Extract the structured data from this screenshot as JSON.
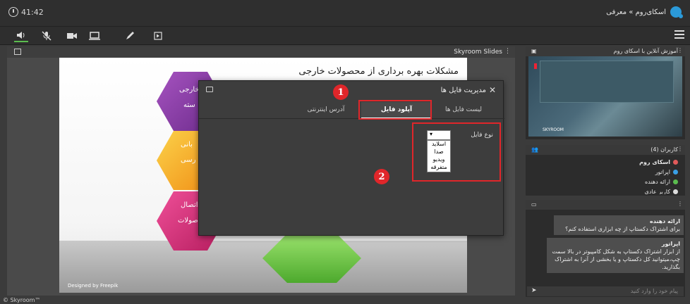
{
  "topbar": {
    "time": "41:42",
    "brand": "اسکای‌روم » معرفی"
  },
  "main": {
    "slides_title": "Skyroom Slides"
  },
  "slide": {
    "title": "مشکلات بهره برداری از محصولات خارجی",
    "hex1_line1": "خارجی",
    "hex1_line2": "سته",
    "hex2_line1": "بانی",
    "hex2_line2": "رسی",
    "hex3_line1": "اتصال",
    "hex3_line2": "صولات",
    "footer": "Designed by Freepik",
    "colors": {
      "hex1": "#8b3fa6",
      "hex2": "#f2b01c",
      "hex3": "#d6307a",
      "hex4": "#6fc94a"
    }
  },
  "dialog": {
    "title": "مدیریت فایل ها",
    "close": "✕",
    "tabs": [
      "لیست فایل ها",
      "آپلود فایل",
      "آدرس اینترنتی"
    ],
    "type_label": "نوع فایل",
    "select_value": "▾",
    "options": [
      "اسلاید",
      "صدا",
      "ویدیو",
      "متفرقه"
    ]
  },
  "annotations": {
    "badge1": "1",
    "badge2": "2",
    "color": "#e0262a"
  },
  "video_panel": {
    "title": "آموزش آنلاین با اسکای روم",
    "logo": "SKYROOM"
  },
  "users_panel": {
    "title": "کاربران (4)",
    "users": [
      {
        "name": "اسکای روم",
        "color": "#e05a5a"
      },
      {
        "name": "اپراتور",
        "color": "#3aa0e6"
      },
      {
        "name": "ارائه دهنده",
        "color": "#5bbd4f"
      },
      {
        "name": "کاربر عادی",
        "color": "#dddddd"
      }
    ]
  },
  "chat_panel": {
    "messages": [
      {
        "sender": "ارائه دهنده",
        "text": "برای اشتراک دکستاپ از چه ابزاری استفاده کنم؟"
      },
      {
        "sender": "اپراتور",
        "text": "از ابزار اشتراک دکستاپ به شکل کامپیوتر در بالا سمت چپ،میتوانید کل دکستاپ و یا بخشی از آنرا به اشتراک بگذارید."
      }
    ],
    "placeholder": "پیام خود را وارد کنید"
  },
  "footer": {
    "copyright": "© Skyroom™"
  }
}
